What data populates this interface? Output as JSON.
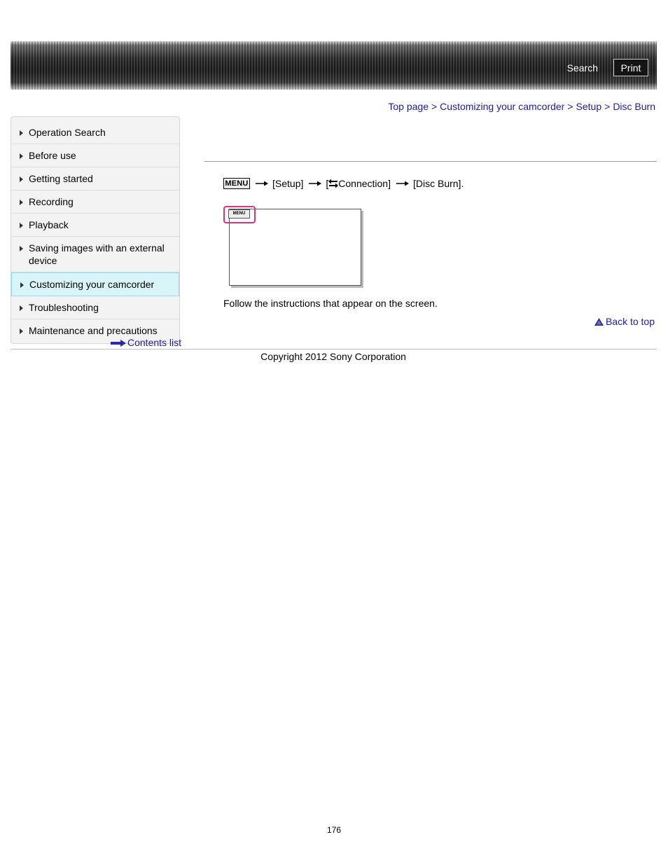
{
  "header": {
    "search_label": "Search",
    "print_label": "Print"
  },
  "breadcrumb": {
    "items": [
      "Top page",
      "Customizing your camcorder",
      "Setup",
      "Disc Burn"
    ],
    "separator": ">"
  },
  "sidebar": {
    "items": [
      {
        "label": "Operation Search"
      },
      {
        "label": "Before use"
      },
      {
        "label": "Getting started"
      },
      {
        "label": "Recording"
      },
      {
        "label": "Playback"
      },
      {
        "label": "Saving images with an external device"
      },
      {
        "label": "Customizing your camcorder",
        "active": true
      },
      {
        "label": "Troubleshooting"
      },
      {
        "label": "Maintenance and precautions"
      }
    ],
    "contents_link": "Contents list"
  },
  "main": {
    "menu_button_label": "MENU",
    "step_setup": "[Setup]",
    "step_connection_open": "[",
    "step_connection": "Connection]",
    "step_disc_burn": "[Disc Burn].",
    "illustration_menu_label": "MENU",
    "instructions": "Follow the instructions that appear on the screen.",
    "back_to_top": "Back to top"
  },
  "footer": {
    "copyright": "Copyright 2012 Sony Corporation",
    "page_number": "176"
  },
  "colors": {
    "link": "#1a1aa6",
    "active_nav_bg": "#d8f6fa",
    "highlight": "#e0307e"
  }
}
